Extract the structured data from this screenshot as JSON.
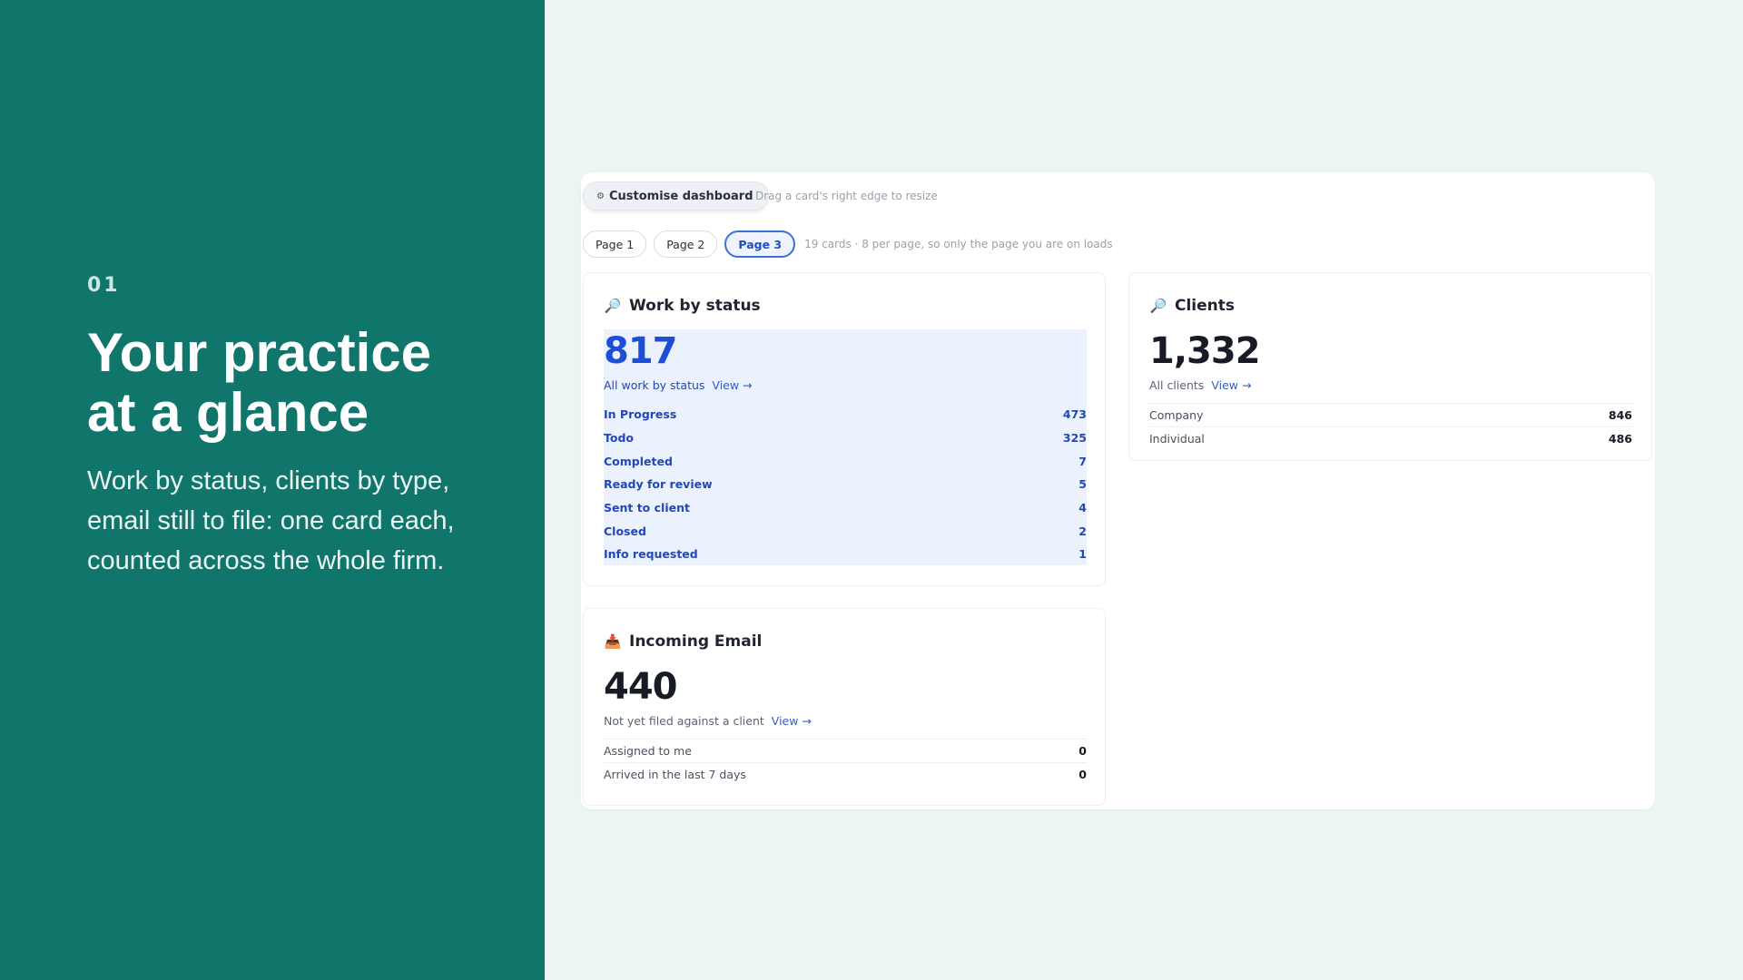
{
  "hero": {
    "step": "01",
    "title": "Your practice at a glance",
    "subtitle": "Work by status, clients by type, email still to file: one card each, counted across the whole firm."
  },
  "toolbar": {
    "customise_label": "Customise dashboard",
    "customise_icon": "gear-icon",
    "hint": "Drag a card's right edge to resize"
  },
  "pager": {
    "pages": [
      "Page 1",
      "Page 2",
      "Page 3"
    ],
    "active": "Page 3",
    "note": "19 cards · 8 per page, so only the page you are on loads"
  },
  "cards": {
    "work": {
      "icon": "magnifier-icon",
      "title": "Work by status",
      "total": "817",
      "sub_label": "All work by status",
      "view": "View →",
      "rows": [
        {
          "label": "In Progress",
          "value": "473"
        },
        {
          "label": "Todo",
          "value": "325"
        },
        {
          "label": "Completed",
          "value": "7"
        },
        {
          "label": "Ready for review",
          "value": "5"
        },
        {
          "label": "Sent to client",
          "value": "4"
        },
        {
          "label": "Closed",
          "value": "2"
        },
        {
          "label": "Info requested",
          "value": "1"
        }
      ]
    },
    "clients": {
      "icon": "magnifier-icon",
      "title": "Clients",
      "total": "1,332",
      "sub_label": "All clients",
      "view": "View →",
      "rows": [
        {
          "label": "Company",
          "value": "846"
        },
        {
          "label": "Individual",
          "value": "486"
        }
      ]
    },
    "email": {
      "icon": "inbox-icon",
      "title": "Incoming Email",
      "total": "440",
      "sub_label": "Not yet filed against a client",
      "view": "View →",
      "rows": [
        {
          "label": "Assigned to me",
          "value": "0"
        },
        {
          "label": "Arrived in the last 7 days",
          "value": "0"
        }
      ]
    }
  }
}
